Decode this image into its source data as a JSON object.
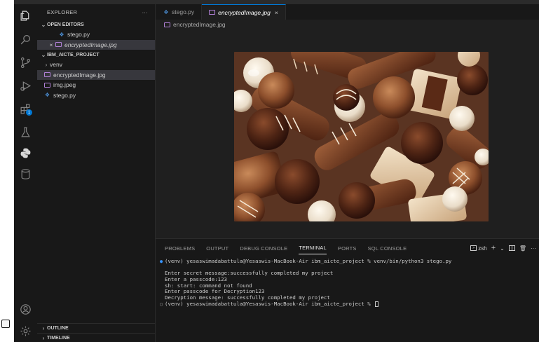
{
  "explorer": {
    "title": "EXPLORER",
    "more": "···",
    "open_editors_label": "OPEN EDITORS",
    "open_editors": [
      {
        "name": "stego.py"
      },
      {
        "name": "encryptedImage.jpg"
      }
    ],
    "project_label": "IBM_AICTE_PROJECT",
    "files": [
      {
        "name": "venv"
      },
      {
        "name": "encryptedImage.jpg"
      },
      {
        "name": "img.jpeg"
      },
      {
        "name": "stego.py"
      }
    ],
    "outline_label": "OUTLINE",
    "timeline_label": "TIMELINE"
  },
  "tabs": [
    {
      "label": "stego.py"
    },
    {
      "label": "encryptedImage.jpg",
      "close": "×"
    }
  ],
  "breadcrumb": "encryptedImage.jpg",
  "panel": {
    "tabs": [
      "PROBLEMS",
      "OUTPUT",
      "DEBUG CONSOLE",
      "TERMINAL",
      "PORTS",
      "SQL CONSOLE"
    ],
    "active_tab": "TERMINAL",
    "shell": "zsh",
    "add": "+",
    "chevron": "⌄",
    "more": "···"
  },
  "terminal": {
    "lines": [
      {
        "marker": "●",
        "text": "(venv) yesaswimadabattula@Yesaswis-MacBook-Air ibm_aicte_project % venv/bin/python3 stego.py"
      },
      {
        "marker": "",
        "text": ""
      },
      {
        "marker": "",
        "text": "Enter secret message:successfully completed my project"
      },
      {
        "marker": "",
        "text": "Enter a passcode:123"
      },
      {
        "marker": "",
        "text": "sh: start: command not found"
      },
      {
        "marker": "",
        "text": "Enter passcode for Decryption123"
      },
      {
        "marker": "",
        "text": "Decryption message: successfully completed my project"
      },
      {
        "marker": "○",
        "text": "(venv) yesaswimadabattula@Yesaswis-MacBook-Air ibm_aicte_project % "
      }
    ]
  },
  "colors": {
    "accent": "#0078d4",
    "success_dot": "#3794ff"
  },
  "icons": {
    "activity": [
      "files-icon",
      "search-icon",
      "source-control-icon",
      "run-debug-icon",
      "extensions-icon",
      "testing-icon",
      "python-icon",
      "database-icon",
      "account-icon",
      "settings-gear-icon"
    ]
  }
}
